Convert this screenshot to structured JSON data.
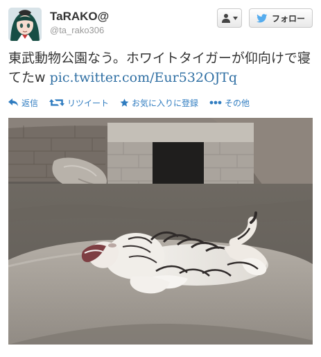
{
  "user": {
    "display_name": "TaRAKO@",
    "screen_name": "@ta_rako306"
  },
  "buttons": {
    "follow_label": "フォロー"
  },
  "tweet": {
    "text": "東武動物公園なう。ホワイトタイガーが仰向けで寝てたw ",
    "link_text": "pic.twitter.com/Eur532OJTq"
  },
  "actions": {
    "reply": "返信",
    "retweet": "リツイート",
    "favorite": "お気に入りに登録",
    "more": "その他"
  },
  "colors": {
    "link": "#2f6fa3",
    "action": "#2f7cc0",
    "twitter_bird": "#55acee"
  },
  "icons": {
    "avatar": "anime-character-avatar",
    "user": "user-icon",
    "bird": "twitter-bird-icon",
    "reply": "reply-arrow-icon",
    "retweet": "retweet-icon",
    "favorite": "star-icon",
    "more": "ellipsis-icon"
  }
}
